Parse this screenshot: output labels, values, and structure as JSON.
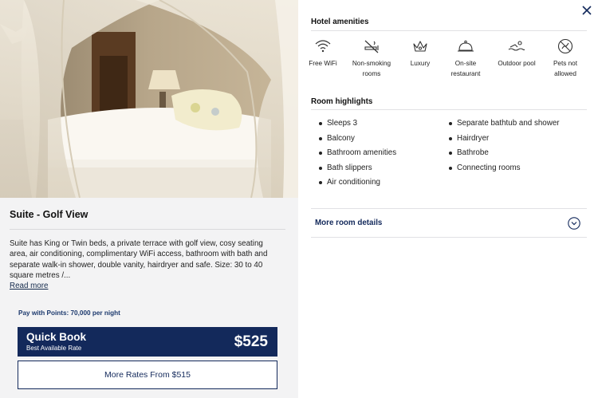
{
  "room": {
    "title": "Suite - Golf View",
    "description": "Suite has King or Twin beds, a private terrace with golf view, cosy seating area, air conditioning, complimentary WiFi access, bathroom with bath and separate walk-in shower, double vanity, hairdryer and safe. Size: 30 to 40 square metres /...",
    "read_more": "Read more"
  },
  "pricing": {
    "points_text": "Pay with Points: 70,000 per night",
    "quick_book_label": "Quick Book",
    "quick_book_sub": "Best Available Rate",
    "quick_book_price": "$525",
    "more_rates": "More Rates From $515"
  },
  "amenities": {
    "title": "Hotel amenities",
    "items": [
      {
        "label": "Free WiFi",
        "icon": "wifi-icon"
      },
      {
        "label": "Non-smoking rooms",
        "icon": "no-smoking-icon"
      },
      {
        "label": "Luxury",
        "icon": "crown-icon"
      },
      {
        "label": "On-site restaurant",
        "icon": "cloche-icon"
      },
      {
        "label": "Outdoor pool",
        "icon": "pool-icon"
      },
      {
        "label": "Pets not allowed",
        "icon": "no-pets-icon"
      }
    ]
  },
  "highlights": {
    "title": "Room highlights",
    "left": [
      "Sleeps 3",
      "Balcony",
      "Bathroom amenities",
      "Bath slippers",
      "Air conditioning"
    ],
    "right": [
      "Separate bathtub and shower",
      "Hairdryer",
      "Bathrobe",
      "Connecting rooms"
    ]
  },
  "more_details": "More room details",
  "colors": {
    "navy": "#13295b",
    "panel_bg": "#f3f3f4",
    "link": "#13294b"
  }
}
